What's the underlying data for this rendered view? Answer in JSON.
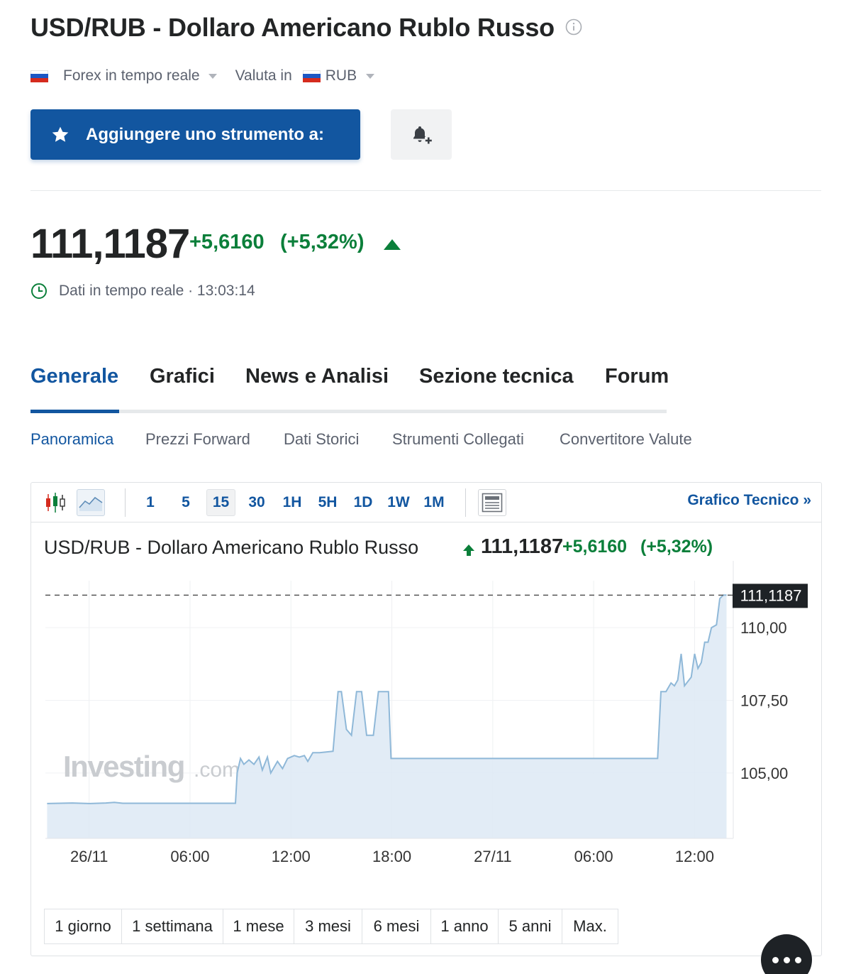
{
  "header": {
    "title": "USD/RUB - Dollaro Americano Rublo Russo",
    "market_label": "Forex in tempo reale",
    "currency_prefix": "Valuta in",
    "currency_value": "RUB"
  },
  "actions": {
    "add_label": "Aggiungere uno strumento a:"
  },
  "quote": {
    "price": "111,1187",
    "change": "+5,6160",
    "change_pct": "(+5,32%)",
    "realtime_label": "Dati in tempo reale · 13:03:14",
    "positive_color": "#0b7f3a"
  },
  "tabs": [
    {
      "label": "Generale",
      "active": true
    },
    {
      "label": "Grafici",
      "active": false
    },
    {
      "label": "News e Analisi",
      "active": false
    },
    {
      "label": "Sezione tecnica",
      "active": false
    },
    {
      "label": "Forum",
      "active": false
    }
  ],
  "subtabs": [
    {
      "label": "Panoramica",
      "active": true
    },
    {
      "label": "Prezzi Forward",
      "active": false
    },
    {
      "label": "Dati Storici",
      "active": false
    },
    {
      "label": "Strumenti Collegati",
      "active": false
    },
    {
      "label": "Convertitore Valute",
      "active": false
    }
  ],
  "chart_widget": {
    "intervals": [
      "1",
      "5",
      "15",
      "30",
      "1H",
      "5H",
      "1D",
      "1W",
      "1M"
    ],
    "active_interval": "15",
    "tech_link": "Grafico Tecnico »",
    "title": "USD/RUB - Dollaro Americano Rublo Russo",
    "price": "111,1187",
    "change": "+5,6160",
    "change_pct": "(+5,32%)",
    "watermark_main": "Investing",
    "watermark_suffix": ".com",
    "ranges": [
      "1 giorno",
      "1 settimana",
      "1 mese",
      "3 mesi",
      "6 mesi",
      "1 anno",
      "5 anni",
      "Max."
    ]
  },
  "chart_data": {
    "type": "area",
    "x_tick_labels": [
      "26/11",
      "06:00",
      "12:00",
      "18:00",
      "27/11",
      "06:00",
      "12:00"
    ],
    "y_tick_labels": [
      "110,00",
      "107,50",
      "105,00"
    ],
    "y_ticks": [
      110.0,
      107.5,
      105.0
    ],
    "last_value_label": "111,1187",
    "last_value": 111.1187,
    "ylim": [
      102.75,
      112.3
    ],
    "x_unit": "hours since 26/11 00:00",
    "xlim": [
      -2.6,
      38.3
    ],
    "series": [
      {
        "color": "#8fb8d8",
        "points": [
          [
            -2.5,
            103.95
          ],
          [
            -1.0,
            103.97
          ],
          [
            0.0,
            103.95
          ],
          [
            1.0,
            103.97
          ],
          [
            1.5,
            103.99
          ],
          [
            2.0,
            103.96
          ],
          [
            4.0,
            103.96
          ],
          [
            6.0,
            103.96
          ],
          [
            8.0,
            103.96
          ],
          [
            8.7,
            103.96
          ],
          [
            8.8,
            105.0
          ],
          [
            9.0,
            105.5
          ],
          [
            9.2,
            105.3
          ],
          [
            9.5,
            105.45
          ],
          [
            9.8,
            105.3
          ],
          [
            10.1,
            105.55
          ],
          [
            10.3,
            105.1
          ],
          [
            10.6,
            105.55
          ],
          [
            10.8,
            105.0
          ],
          [
            11.2,
            105.4
          ],
          [
            11.5,
            105.15
          ],
          [
            11.8,
            105.5
          ],
          [
            12.2,
            105.6
          ],
          [
            12.5,
            105.55
          ],
          [
            12.8,
            105.6
          ],
          [
            13.0,
            105.4
          ],
          [
            13.3,
            105.7
          ],
          [
            13.7,
            105.7
          ],
          [
            14.2,
            105.73
          ],
          [
            14.5,
            105.75
          ],
          [
            14.8,
            107.8
          ],
          [
            15.0,
            107.8
          ],
          [
            15.3,
            106.5
          ],
          [
            15.6,
            106.3
          ],
          [
            15.9,
            107.8
          ],
          [
            16.2,
            107.8
          ],
          [
            16.5,
            106.3
          ],
          [
            16.9,
            106.3
          ],
          [
            17.2,
            107.8
          ],
          [
            17.8,
            107.8
          ],
          [
            17.95,
            105.5
          ],
          [
            20.0,
            105.5
          ],
          [
            24.0,
            105.5
          ],
          [
            28.0,
            105.5
          ],
          [
            32.0,
            105.5
          ],
          [
            33.8,
            105.5
          ],
          [
            34.0,
            107.8
          ],
          [
            34.3,
            107.8
          ],
          [
            34.6,
            108.1
          ],
          [
            34.8,
            108.0
          ],
          [
            35.0,
            108.2
          ],
          [
            35.2,
            109.1
          ],
          [
            35.4,
            108.0
          ],
          [
            35.6,
            108.15
          ],
          [
            35.8,
            108.3
          ],
          [
            36.0,
            109.1
          ],
          [
            36.2,
            108.6
          ],
          [
            36.4,
            108.8
          ],
          [
            36.6,
            109.5
          ],
          [
            36.8,
            109.5
          ],
          [
            37.0,
            110.0
          ],
          [
            37.3,
            110.1
          ],
          [
            37.5,
            111.0
          ],
          [
            37.7,
            111.12
          ],
          [
            37.9,
            111.12
          ]
        ]
      }
    ]
  }
}
